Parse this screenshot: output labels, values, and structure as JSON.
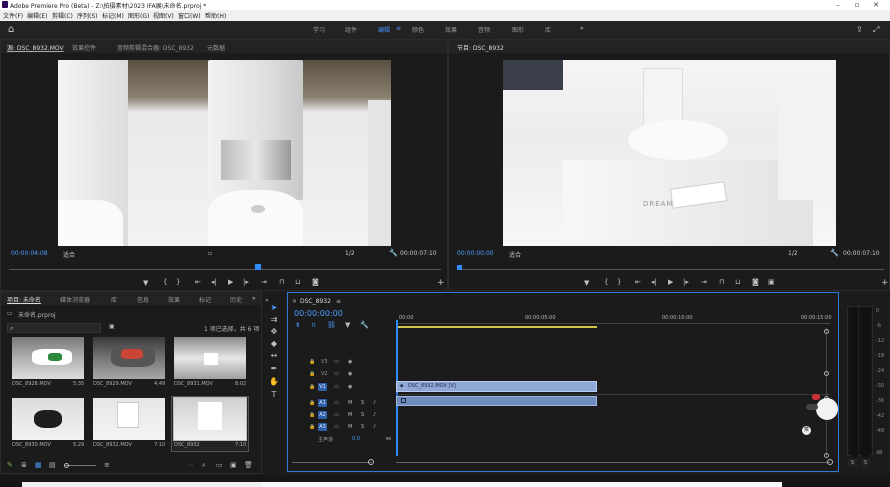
{
  "window": {
    "title": "Adobe Premiere Pro (Beta) - Z:\\拍摄素材\\2023 IFA展\\未命名.prproj *"
  },
  "menu": [
    "文件(F)",
    "编辑(E)",
    "剪辑(C)",
    "序列(S)",
    "标记(M)",
    "图形(G)",
    "视图(V)",
    "窗口(W)",
    "帮助(H)"
  ],
  "workspaces": [
    {
      "label": "学习",
      "active": false
    },
    {
      "label": "组件",
      "active": false
    },
    {
      "label": "编辑",
      "active": true
    },
    {
      "label": "颜色",
      "active": false
    },
    {
      "label": "效果",
      "active": false
    },
    {
      "label": "音频",
      "active": false
    },
    {
      "label": "图形",
      "active": false
    },
    {
      "label": "库",
      "active": false
    }
  ],
  "workspace_more": "»",
  "source": {
    "tabs": [
      "源: DSC_8932.MOV",
      "效果控件",
      "音频剪辑混合器: DSC_8932",
      "元数据"
    ],
    "timecode": "00:00:04:08",
    "fit": "适合",
    "ratio": "1/2",
    "duration": "00:00:07:10"
  },
  "program": {
    "tabs": [
      "节目: DSC_8932"
    ],
    "timecode": "00:00:00:00",
    "fit": "适合",
    "ratio": "1/2",
    "duration": "00:00:07:10"
  },
  "project": {
    "tabs": [
      "项目: 未命名",
      "媒体浏览器",
      "库",
      "信息",
      "效果",
      "标记",
      "历史"
    ],
    "filename": "未命名.prproj",
    "selection": "1 项已选择，共 6 项",
    "clips": [
      {
        "name": "DSC_8928.MOV",
        "dur": "5:35"
      },
      {
        "name": "DSC_8929.MOV",
        "dur": "4:49"
      },
      {
        "name": "DSC_8931.MOV",
        "dur": "8:02"
      },
      {
        "name": "DSC_8930.MOV",
        "dur": "5:29"
      },
      {
        "name": "DSC_8932.MOV",
        "dur": "7:10"
      },
      {
        "name": "DSC_8932",
        "dur": "7:10"
      }
    ]
  },
  "timeline": {
    "tab": "DSC_8932",
    "timecode": "00:00:00:00",
    "ruler": [
      "00:00",
      "00:00:05:00",
      "00:00:10:00",
      "00:00:15:00"
    ],
    "video_tracks": [
      "V3",
      "V2",
      "V1"
    ],
    "audio_tracks": [
      "A1",
      "A2",
      "A3"
    ],
    "master": "主声道",
    "master_val": "0.0",
    "clip_video_label": "DSC_8932.MOV [V]"
  },
  "meter": {
    "scale": [
      "0",
      "-6",
      "-12",
      "-18",
      "-24",
      "-30",
      "-36",
      "-42",
      "-48",
      "dB"
    ],
    "solo": [
      "S",
      "S"
    ]
  },
  "accent": "#2d8cff"
}
